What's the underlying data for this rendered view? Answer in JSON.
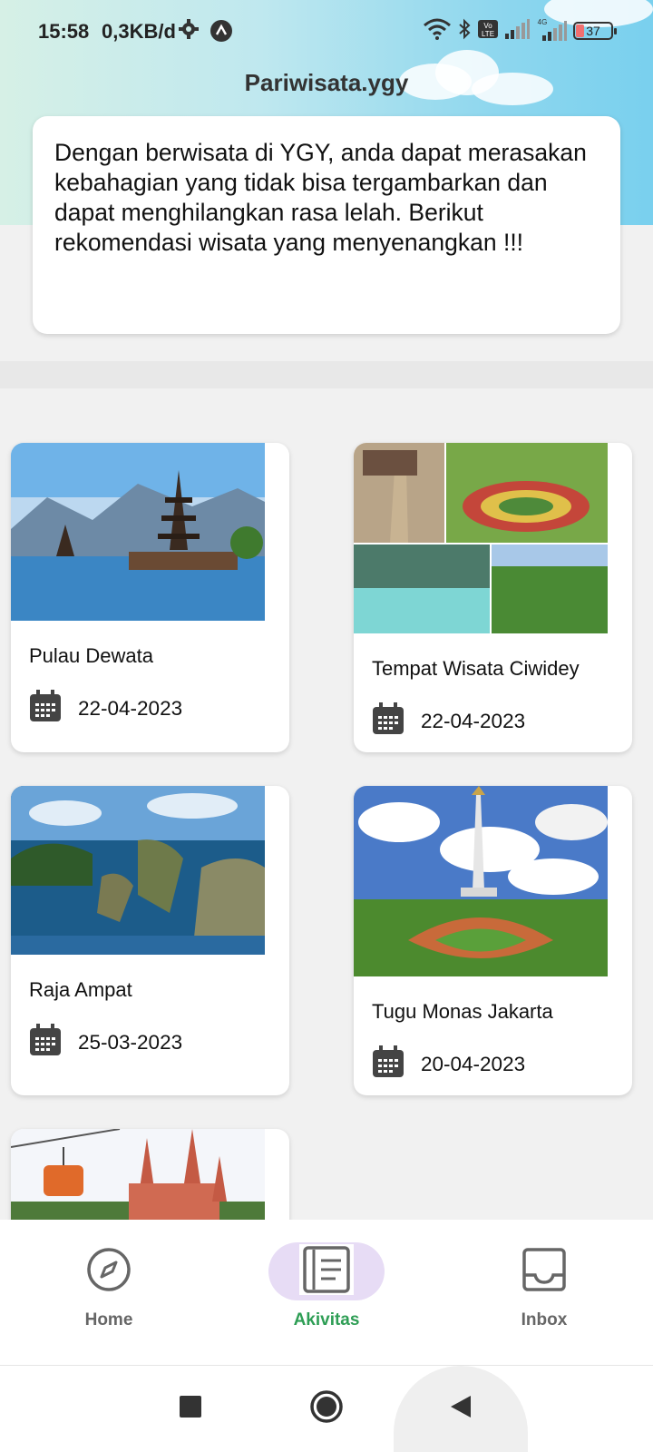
{
  "status_bar": {
    "time": "15:58",
    "net_speed": "0,3KB/d",
    "battery": "37"
  },
  "app": {
    "title": "Pariwisata.ygy"
  },
  "intro": {
    "text": "Dengan berwisata di YGY, anda dapat merasakan kebahagian yang tidak bisa tergambarkan dan dapat menghilangkan rasa lelah. Berikut rekomendasi wisata yang menyenangkan !!!"
  },
  "destinations": [
    {
      "name": "Pulau Dewata",
      "date": "22-04-2023",
      "image": "temple-on-lake"
    },
    {
      "name": "Tempat Wisata Ciwidey",
      "date": "22-04-2023",
      "image": "ciwidey-collage"
    },
    {
      "name": "Raja Ampat",
      "date": "25-03-2023",
      "image": "island-lagoon"
    },
    {
      "name": "Tugu Monas Jakarta",
      "date": "20-04-2023",
      "image": "monas-monument"
    },
    {
      "name": "",
      "date": "",
      "image": "castle-cable-car"
    }
  ],
  "bottom_nav": {
    "items": [
      {
        "label": "Home",
        "icon": "compass-icon",
        "active": false
      },
      {
        "label": "Akivitas",
        "icon": "activity-list-icon",
        "active": true
      },
      {
        "label": "Inbox",
        "icon": "inbox-icon",
        "active": false
      }
    ]
  },
  "colors": {
    "active_label": "#2e9e55",
    "active_pill": "#e7dcf5",
    "header_sky": "#8fd7ee"
  }
}
